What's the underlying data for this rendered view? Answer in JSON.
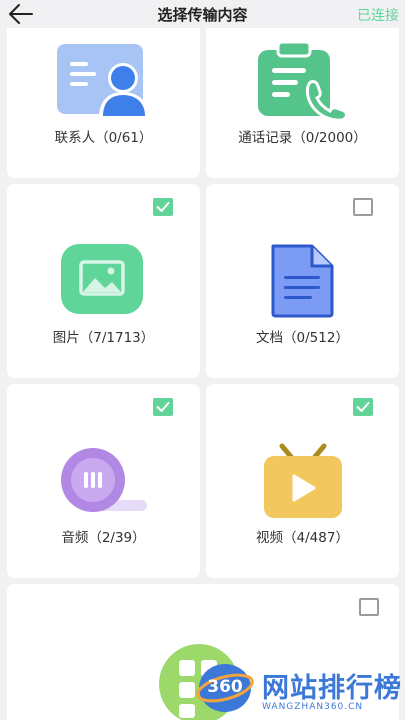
{
  "header": {
    "title": "选择传输内容",
    "status": "已连接"
  },
  "categories": [
    {
      "label": "联系人（0/61）",
      "selected": null,
      "icon": "contacts-icon"
    },
    {
      "label": "通话记录（0/2000）",
      "selected": null,
      "icon": "call-log-icon"
    },
    {
      "label": "图片（7/1713）",
      "selected": true,
      "icon": "image-icon"
    },
    {
      "label": "文档（0/512）",
      "selected": false,
      "icon": "document-icon"
    },
    {
      "label": "音频（2/39）",
      "selected": true,
      "icon": "audio-icon"
    },
    {
      "label": "视频（4/487）",
      "selected": true,
      "icon": "video-icon"
    },
    {
      "label": "",
      "selected": false,
      "icon": "apps-icon"
    }
  ],
  "watermark": {
    "logo_text": "360",
    "brand": "网站排行榜",
    "domain": "WANGZHAN360.CN"
  },
  "colors": {
    "accent": "#62d49a",
    "status": "#5fd59a",
    "watermark": "#3b78d8"
  }
}
